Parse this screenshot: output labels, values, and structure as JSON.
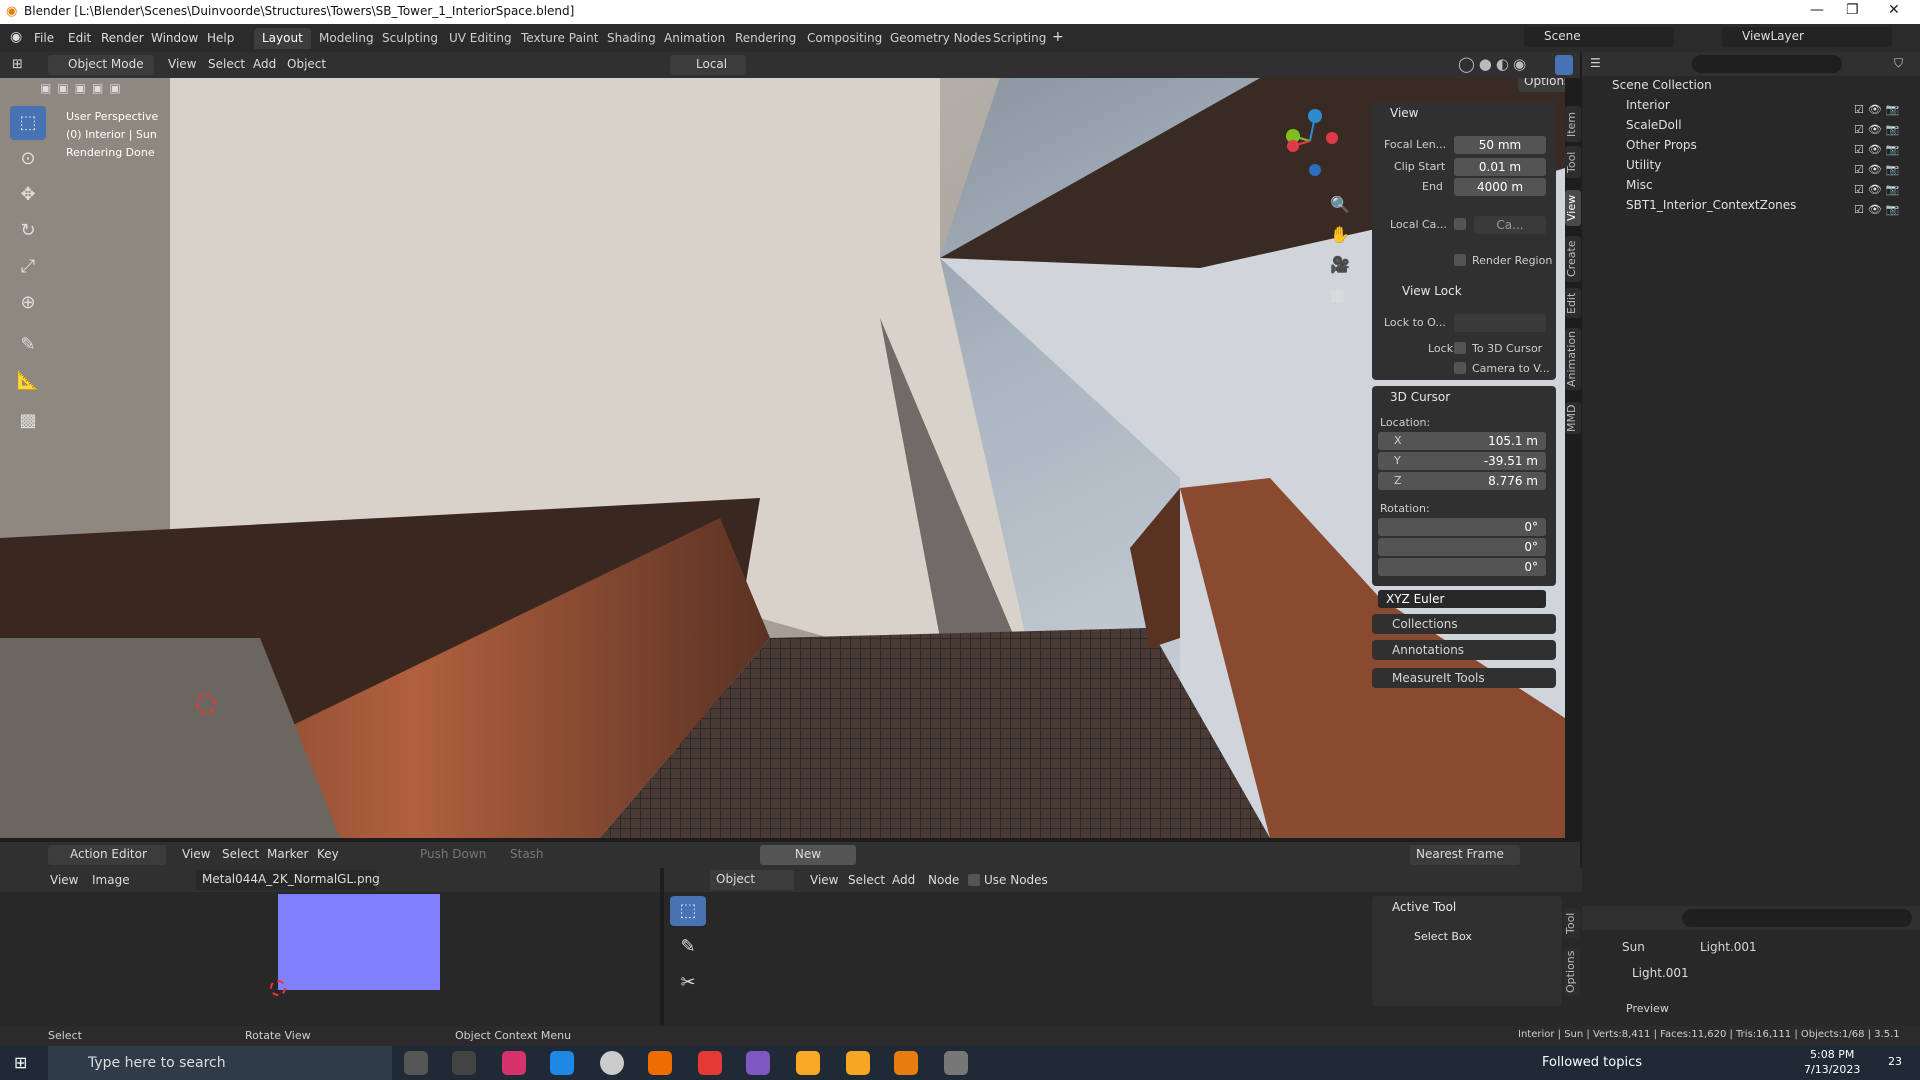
{
  "app": {
    "title": "Blender [L:\\Blender\\Scenes\\Duinvoorde\\Structures\\Towers\\SB_Tower_1_InteriorSpace.blend]"
  },
  "menu": [
    "File",
    "Edit",
    "Render",
    "Window",
    "Help"
  ],
  "workspaces": [
    "Layout",
    "Modeling",
    "Sculpting",
    "UV Editing",
    "Texture Paint",
    "Shading",
    "Animation",
    "Rendering",
    "Compositing",
    "Geometry Nodes",
    "Scripting"
  ],
  "scene": {
    "name": "Scene",
    "view_layer": "ViewLayer"
  },
  "viewport_header": {
    "mode": "Object Mode",
    "menus": [
      "View",
      "Select",
      "Add",
      "Object"
    ],
    "transform": "Local",
    "options": "Options"
  },
  "overlay_text": {
    "line1": "User Perspective",
    "line2": "(0) Interior | Sun",
    "line3": "Rendering Done"
  },
  "npanel": {
    "view": {
      "title": "View",
      "focal_label": "Focal Len...",
      "focal": "50 mm",
      "clip_start_label": "Clip Start",
      "clip_start": "0.01 m",
      "end_label": "End",
      "end": "4000 m",
      "local_cam_label": "Local Ca...",
      "local_cam": "Ca...",
      "render_region": "Render Region"
    },
    "view_lock": {
      "title": "View Lock",
      "lock_to_label": "Lock to O...",
      "lock_label": "Lock",
      "to_cursor": "To 3D Cursor",
      "camera_to": "Camera to V..."
    },
    "cursor": {
      "title": "3D Cursor",
      "location": "Location:",
      "x": "105.1 m",
      "y": "-39.51 m",
      "z": "8.776 m",
      "rotation": "Rotation:",
      "rx": "0°",
      "ry": "0°",
      "rz": "0°",
      "mode": "XYZ Euler",
      "X": "X",
      "Y": "Y",
      "Z": "Z"
    },
    "collapsed": [
      "Collections",
      "Annotations",
      "MeasureIt Tools"
    ]
  },
  "side_tabs": [
    "Item",
    "Tool",
    "View",
    "Create",
    "Edit",
    "Animation",
    "MMD"
  ],
  "outliner": {
    "root": "Scene Collection",
    "items": [
      "Interior",
      "ScaleDoll",
      "Other Props",
      "Utility",
      "Misc",
      "SBT1_Interior_ContextZones"
    ]
  },
  "dope": {
    "mode": "Action Editor",
    "menus": [
      "View",
      "Select",
      "Marker",
      "Key"
    ],
    "push_down": "Push Down",
    "stash": "Stash",
    "new": "New",
    "interp": "Nearest Frame"
  },
  "image_editor": {
    "menus": [
      "View",
      "Image"
    ],
    "image": "Metal044A_2K_NormalGL.png",
    "swatch": "#8080ff"
  },
  "node_editor": {
    "type": "Object",
    "menus": [
      "View",
      "Select",
      "Add",
      "Node"
    ],
    "use_nodes": "Use Nodes",
    "active_tool_title": "Active Tool",
    "tool": "Select Box",
    "tabs": [
      "Tool",
      "Options"
    ]
  },
  "properties": {
    "crumb1": "Sun",
    "crumb2": "Light.001",
    "name": "Light.001",
    "preview": "Preview"
  },
  "status": {
    "select": "Select",
    "rotate": "Rotate View",
    "context": "Object Context Menu",
    "stats": "Interior | Sun | Verts:8,411 | Faces:11,620 | Tris:16,111 | Objects:1/68 | 3.5.1"
  },
  "taskbar": {
    "search": "Type here to search",
    "news": "Followed topics",
    "time": "5:08 PM",
    "date": "7/13/2023",
    "notif": "23"
  }
}
